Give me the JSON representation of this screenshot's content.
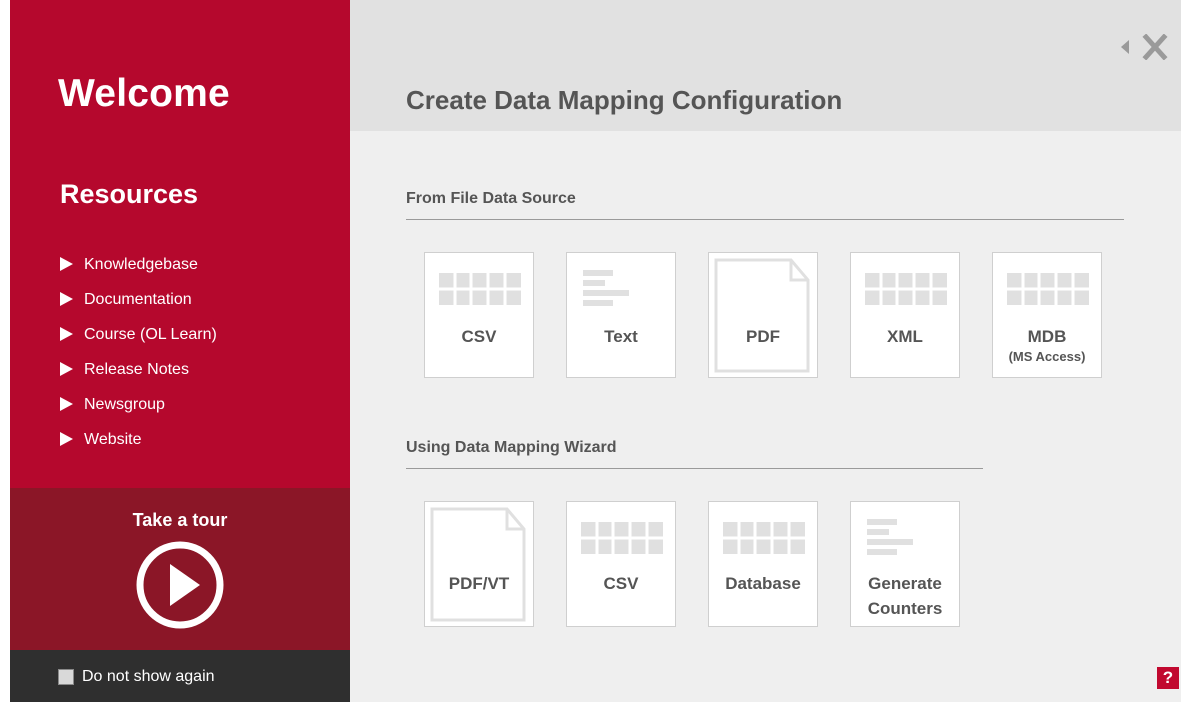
{
  "sidebar": {
    "welcome": "Welcome",
    "resources_title": "Resources",
    "links": [
      "Knowledgebase",
      "Documentation",
      "Course (OL Learn)",
      "Release Notes",
      "Newsgroup",
      "Website"
    ],
    "tour_title": "Take a tour",
    "do_not_show": "Do not show again",
    "do_not_show_checked": false
  },
  "main": {
    "title": "Create Data Mapping Configuration",
    "section_file": "From File Data Source",
    "section_wizard": "Using Data Mapping Wizard",
    "file_tiles": [
      {
        "label": "CSV",
        "icon": "table-icon"
      },
      {
        "label": "Text",
        "icon": "text-lines-icon"
      },
      {
        "label": "PDF",
        "icon": "document-icon"
      },
      {
        "label": "XML",
        "icon": "table-icon"
      },
      {
        "label": "MDB",
        "sublabel": "(MS Access)",
        "icon": "table-icon"
      }
    ],
    "wizard_tiles": [
      {
        "label": "PDF/VT",
        "icon": "document-icon"
      },
      {
        "label": "CSV",
        "icon": "table-icon"
      },
      {
        "label": "Database",
        "icon": "table-icon"
      },
      {
        "label": "Generate",
        "label2": "Counters",
        "icon": "text-lines-icon"
      }
    ],
    "help": "?"
  },
  "colors": {
    "sidebar_red": "#b5082d",
    "tour_dark_red": "#8b1627",
    "footer_dark": "#2f2f2f",
    "header_gray": "#e1e1e1",
    "body_gray": "#efefef",
    "tile_icon_gray": "#e0e0e0",
    "text_gray": "#555555"
  }
}
